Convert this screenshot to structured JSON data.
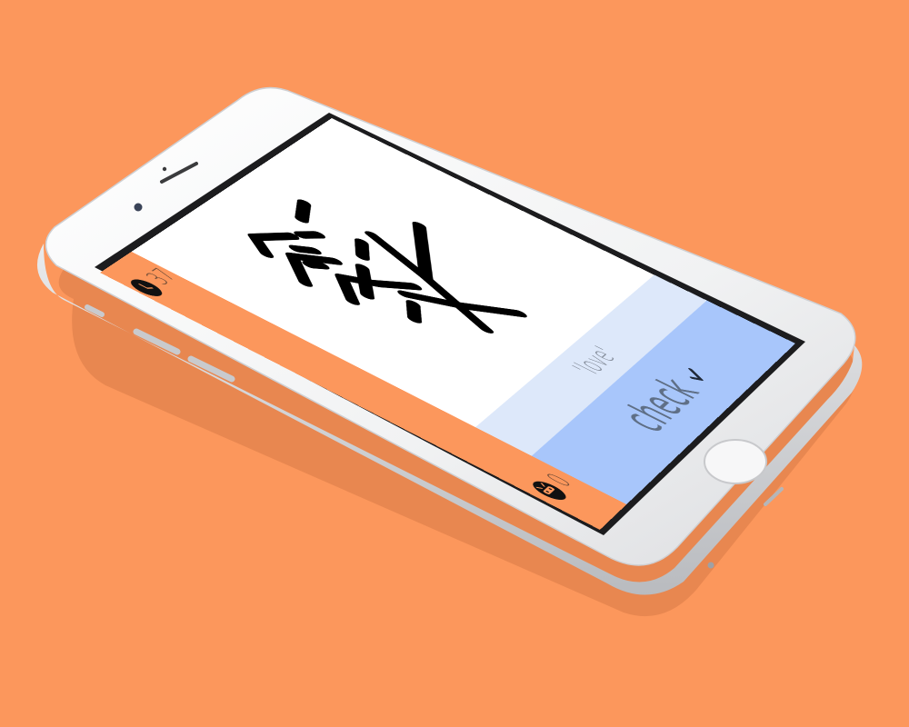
{
  "app": {
    "timer_value": "37",
    "timer_icon": "clock-icon",
    "score_value": "0",
    "score_icon": "ninja-icon",
    "meaning_text": "'love'",
    "check_label": "check",
    "check_icon": "checkmark-icon",
    "kanji_icon": "drawn-kanji-love"
  },
  "colors": {
    "background": "#FC975C",
    "sidebar": "#FC975C",
    "meaning_bar": "#DDE8FA",
    "check_bar": "#A8C6FB"
  }
}
